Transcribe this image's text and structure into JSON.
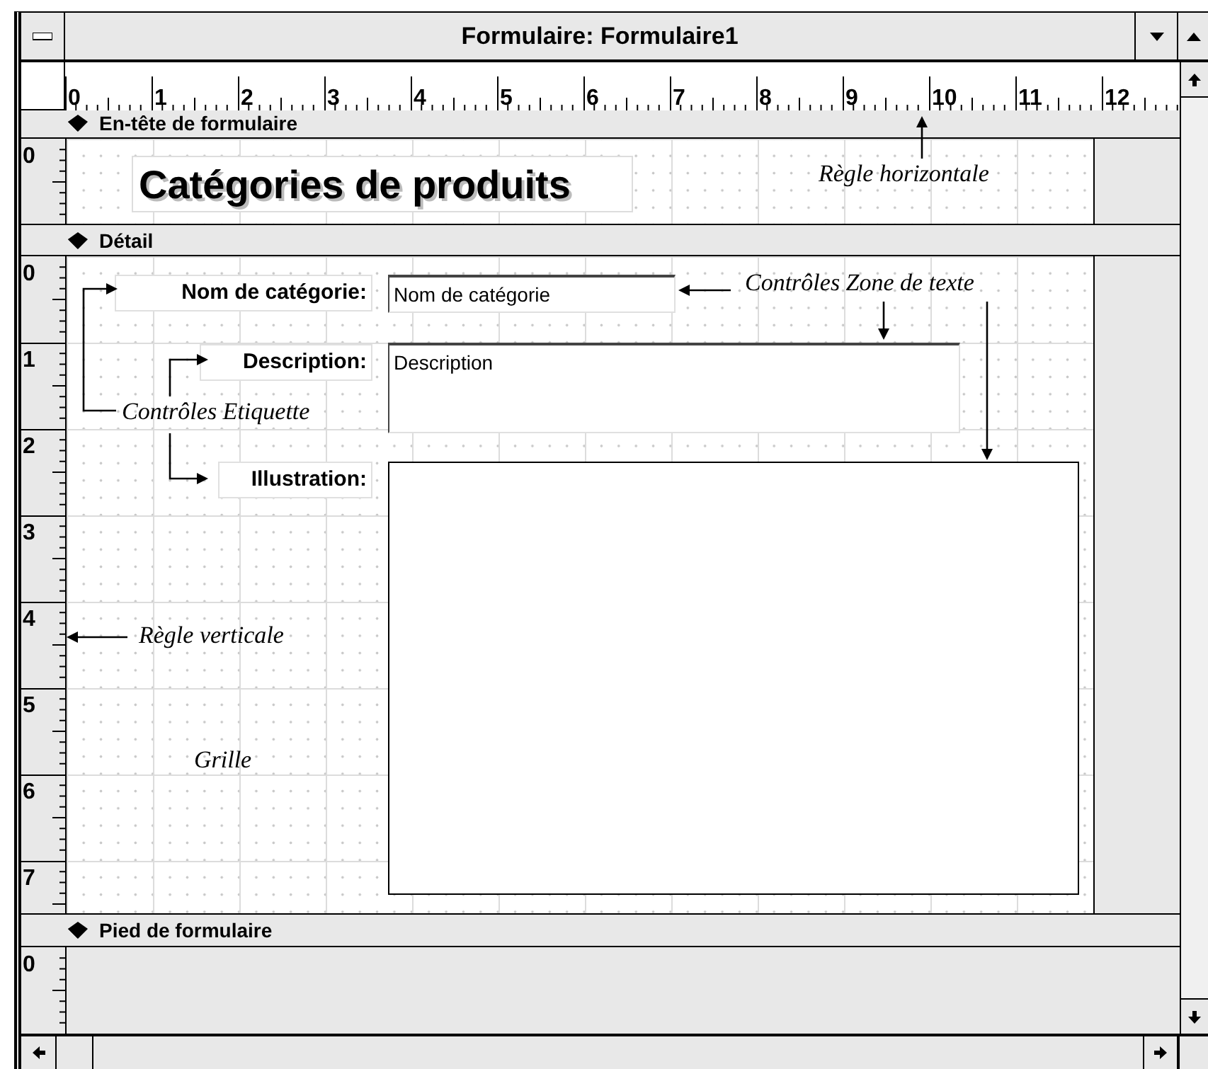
{
  "window": {
    "title": "Formulaire: Formulaire1"
  },
  "ruler": {
    "ticks": [
      "0",
      "1",
      "2",
      "3",
      "4",
      "5",
      "6",
      "7",
      "8",
      "9",
      "10",
      "11",
      "12"
    ]
  },
  "sections": [
    {
      "kind": "header",
      "title": "En-tête de formulaire",
      "ruler_ticks": [
        "0"
      ],
      "controls": [
        {
          "kind": "title",
          "text": "Catégories de produits"
        }
      ]
    },
    {
      "kind": "detail",
      "title": "Détail",
      "ruler_ticks": [
        "0",
        "1",
        "2",
        "3",
        "4",
        "5",
        "6",
        "7"
      ],
      "controls": [
        {
          "kind": "label",
          "text": "Nom de catégorie:"
        },
        {
          "kind": "textbox",
          "text": "Nom de catégorie"
        },
        {
          "kind": "label",
          "text": "Description:"
        },
        {
          "kind": "textbox",
          "text": "Description"
        },
        {
          "kind": "label",
          "text": "Illustration:"
        },
        {
          "kind": "frame"
        }
      ]
    },
    {
      "kind": "footer",
      "title": "Pied de formulaire",
      "ruler_ticks": [
        "0"
      ]
    }
  ],
  "annotations": [
    {
      "text": "Règle horizontale"
    },
    {
      "text": "Contrôles Zone de texte"
    },
    {
      "text": "Contrôles Etiquette"
    },
    {
      "text": "Règle verticale"
    },
    {
      "text": "Grille"
    }
  ]
}
